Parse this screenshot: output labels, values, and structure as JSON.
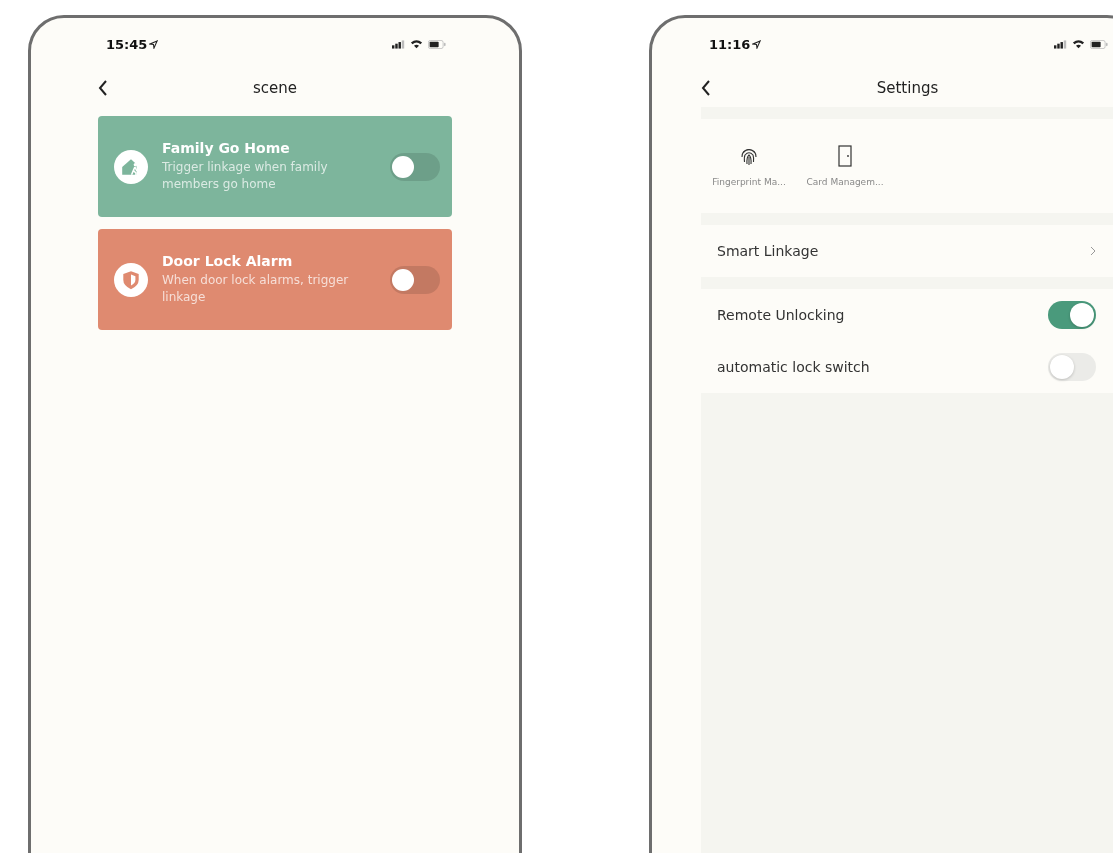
{
  "scene_screen": {
    "status_time": "15:45",
    "title": "scene",
    "scenes": [
      {
        "kind": "home",
        "title": "Family Go Home",
        "description": "Trigger linkage when family members go home",
        "color": "#7db59c",
        "on": false
      },
      {
        "kind": "alarm",
        "title": "Door Lock Alarm",
        "description": "When door lock alarms, trigger linkage",
        "color": "#df8a70",
        "on": false
      }
    ]
  },
  "settings_screen": {
    "status_time": "11:16",
    "title": "Settings",
    "shortcuts": [
      {
        "kind": "fingerprint",
        "label": "Fingerprint Ma..."
      },
      {
        "kind": "door",
        "label": "Card Managem..."
      }
    ],
    "groups": [
      [
        {
          "kind": "link",
          "label": "Smart Linkage"
        }
      ],
      [
        {
          "kind": "switch",
          "label": "Remote Unlocking",
          "on": true
        },
        {
          "kind": "switch",
          "label": "automatic lock switch",
          "on": false
        }
      ]
    ]
  }
}
